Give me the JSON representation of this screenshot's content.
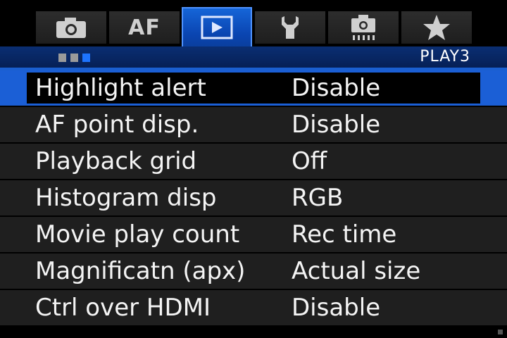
{
  "tabs": [
    {
      "name": "shooting",
      "icon": "camera-icon"
    },
    {
      "name": "af",
      "label": "AF"
    },
    {
      "name": "playback",
      "icon": "play-icon",
      "selected": true
    },
    {
      "name": "setup",
      "icon": "wrench-icon"
    },
    {
      "name": "custom-functions",
      "icon": "custom-camera-icon"
    },
    {
      "name": "my-menu",
      "icon": "star-icon"
    }
  ],
  "subheader": {
    "page_label": "PLAY3",
    "page_indicator": {
      "total": 3,
      "active": 3
    }
  },
  "menu_items": [
    {
      "label": "Highlight alert",
      "value": "Disable",
      "selected": true
    },
    {
      "label": "AF point disp.",
      "value": "Disable"
    },
    {
      "label": "Playback grid",
      "value": "Off"
    },
    {
      "label": "Histogram disp",
      "value": "RGB"
    },
    {
      "label": "Movie play count",
      "value": "Rec time"
    },
    {
      "label": "Magnificatn (apx)",
      "value": "Actual size"
    },
    {
      "label": "Ctrl over HDMI",
      "value": "Disable"
    }
  ],
  "colors": {
    "selected_tab": "#0a44b0",
    "selection_highlight": "#1b5fd6",
    "background": "#000000",
    "row": "#1f1f1f"
  }
}
